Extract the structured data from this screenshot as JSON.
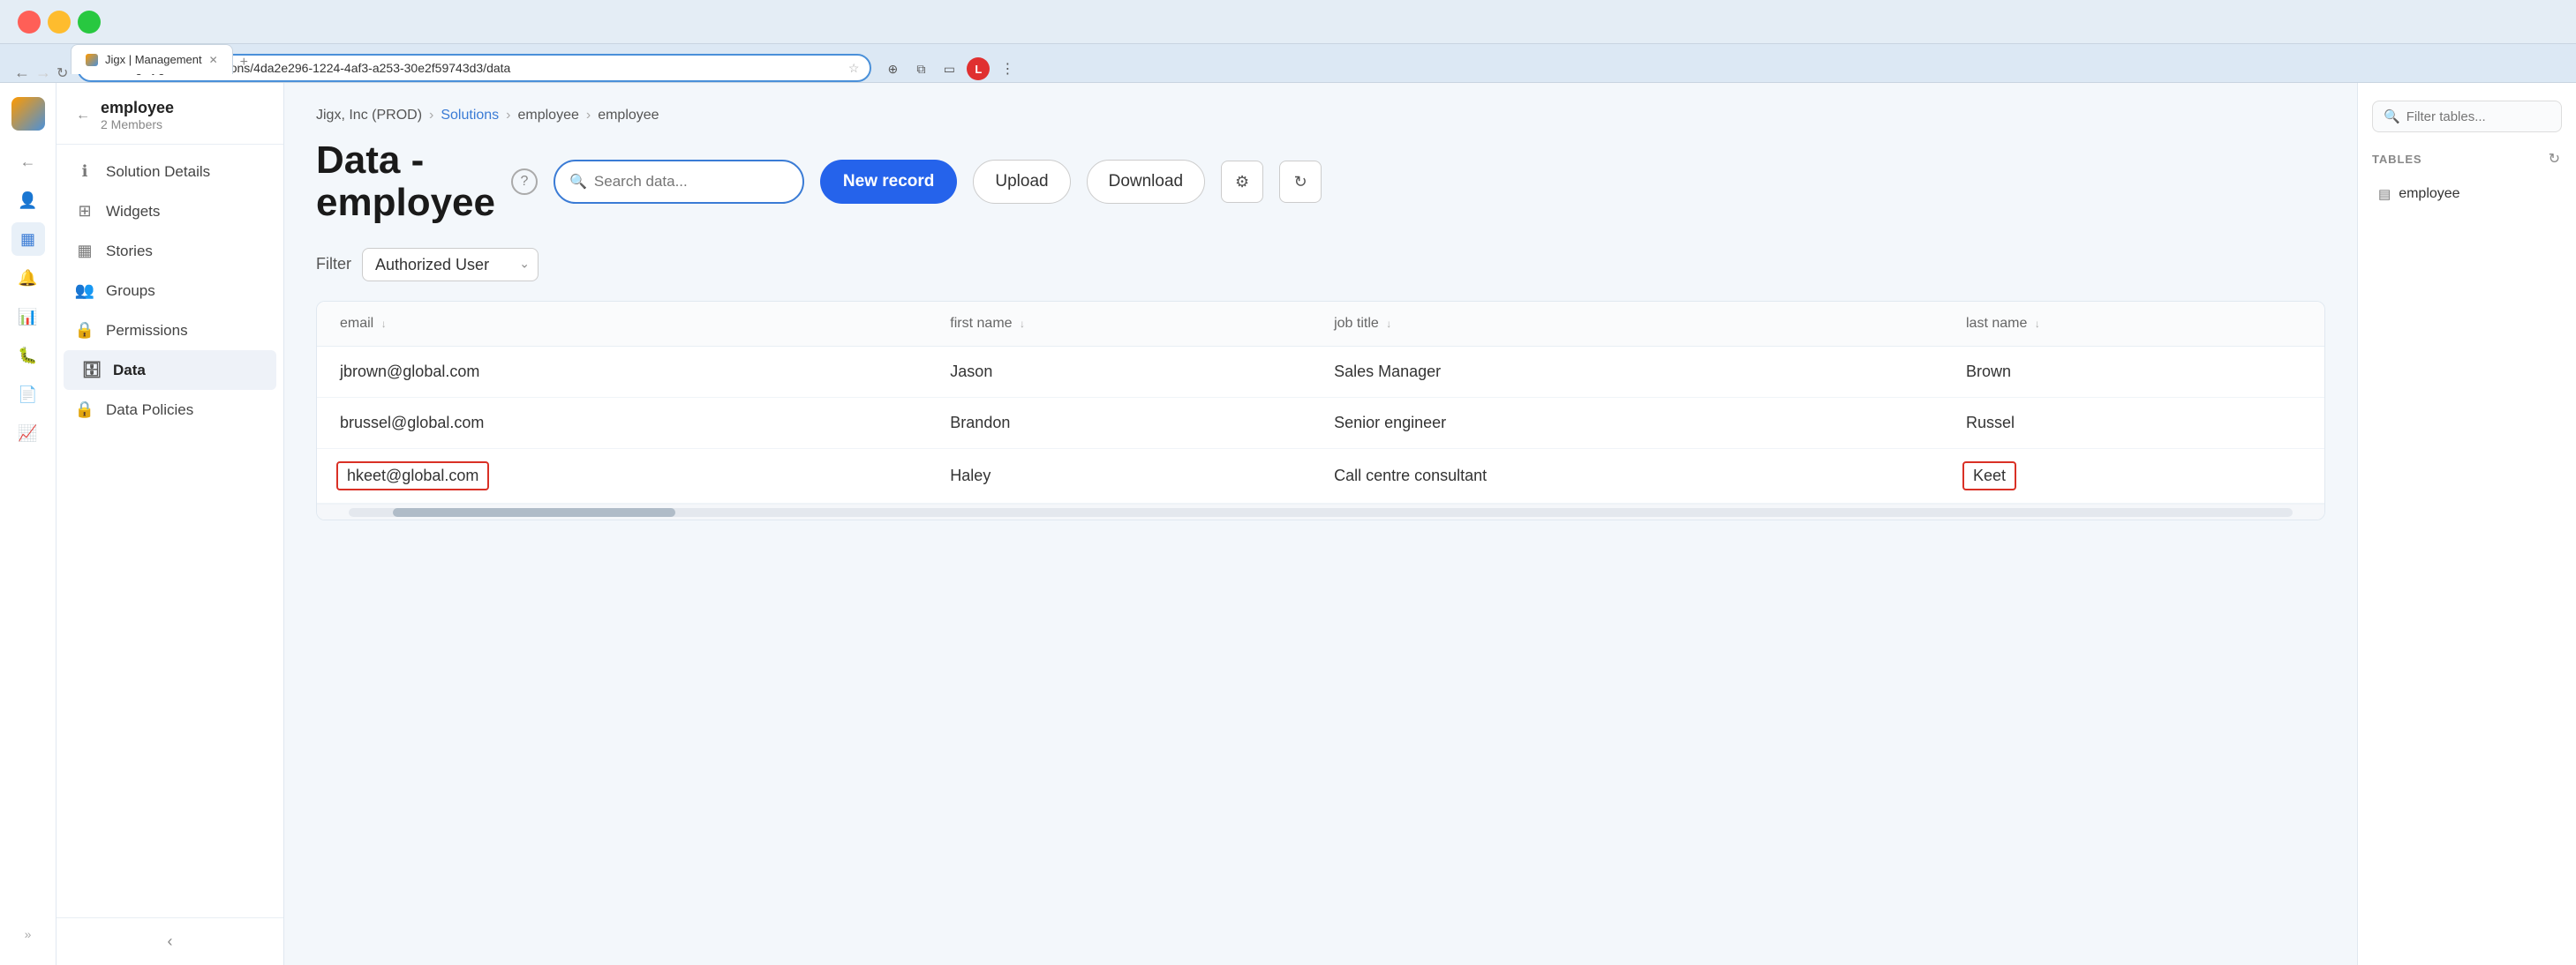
{
  "browser": {
    "tab_title": "Jigx | Management",
    "url": "manage.jigx.com/solutions/4da2e296-1224-4af3-a253-30e2f59743d3/data",
    "new_tab_tooltip": "New tab"
  },
  "breadcrumb": {
    "org": "Jigx, Inc (PROD)",
    "solutions_link": "Solutions",
    "section1": "employee",
    "section2": "employee"
  },
  "page": {
    "title": "Data -\nemployee",
    "title_line1": "Data -",
    "title_line2": "employee"
  },
  "search": {
    "placeholder": "Search data..."
  },
  "buttons": {
    "new_record": "New record",
    "upload": "Upload",
    "download": "Download"
  },
  "filter": {
    "label": "Filter",
    "value": "Authorized User"
  },
  "table": {
    "columns": [
      "email",
      "first name",
      "job title",
      "last name"
    ],
    "rows": [
      {
        "email": "jbrown@global.com",
        "first_name": "Jason",
        "job_title": "Sales Manager",
        "last_name": "Brown",
        "highlight_email": false,
        "highlight_last": false
      },
      {
        "email": "brussel@global.com",
        "first_name": "Brandon",
        "job_title": "Senior engineer",
        "last_name": "Russel",
        "highlight_email": false,
        "highlight_last": false
      },
      {
        "email": "hkeet@global.com",
        "first_name": "Haley",
        "job_title": "Call centre consultant",
        "last_name": "Keet",
        "highlight_email": true,
        "highlight_last": true
      }
    ]
  },
  "sidebar": {
    "workspace_name": "employee",
    "workspace_members": "2 Members",
    "items": [
      {
        "id": "solution-details",
        "label": "Solution Details",
        "icon": "ℹ"
      },
      {
        "id": "widgets",
        "label": "Widgets",
        "icon": "⊞"
      },
      {
        "id": "stories",
        "label": "Stories",
        "icon": "▦"
      },
      {
        "id": "groups",
        "label": "Groups",
        "icon": "👥"
      },
      {
        "id": "permissions",
        "label": "Permissions",
        "icon": "🔒"
      },
      {
        "id": "data",
        "label": "Data",
        "icon": "🗄"
      },
      {
        "id": "data-policies",
        "label": "Data Policies",
        "icon": "🔒"
      }
    ],
    "collapse_label": "Collapse"
  },
  "right_panel": {
    "search_placeholder": "Filter tables...",
    "tables_label": "TABLES",
    "tables": [
      {
        "id": "employee",
        "label": "employee"
      }
    ]
  },
  "icons": {
    "back": "←",
    "chevron_right": "›",
    "sort_down": "↓",
    "gear": "⚙",
    "refresh": "↻",
    "search": "🔍",
    "table": "▤",
    "collapse_left": "‹",
    "expand_right": "›"
  }
}
